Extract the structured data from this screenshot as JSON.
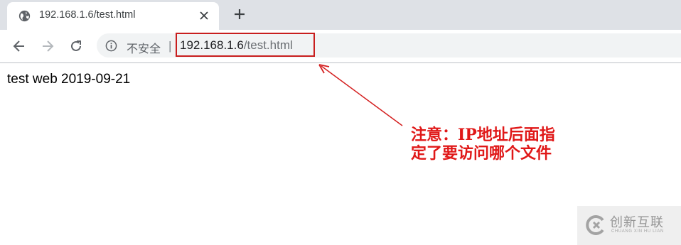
{
  "tab": {
    "title": "192.168.1.6/test.html",
    "favicon": "globe-icon",
    "close": "close-icon"
  },
  "new_tab": "plus-icon",
  "toolbar": {
    "back": "arrow-left-icon",
    "forward": "arrow-right-icon",
    "reload": "reload-icon"
  },
  "omnibox": {
    "info_icon": "info-icon",
    "security_label": "不安全",
    "separator": "|",
    "url_host": "192.168.1.6",
    "url_path": "/test.html"
  },
  "page": {
    "body_text": "test web 2019-09-21"
  },
  "annotation": {
    "line1": "注意：IP地址后面指",
    "line2": "定了要访问哪个文件",
    "color": "#e01818"
  },
  "watermark": {
    "brand": "创新互联",
    "subtitle": "CHUANG XIN HU LIAN"
  }
}
